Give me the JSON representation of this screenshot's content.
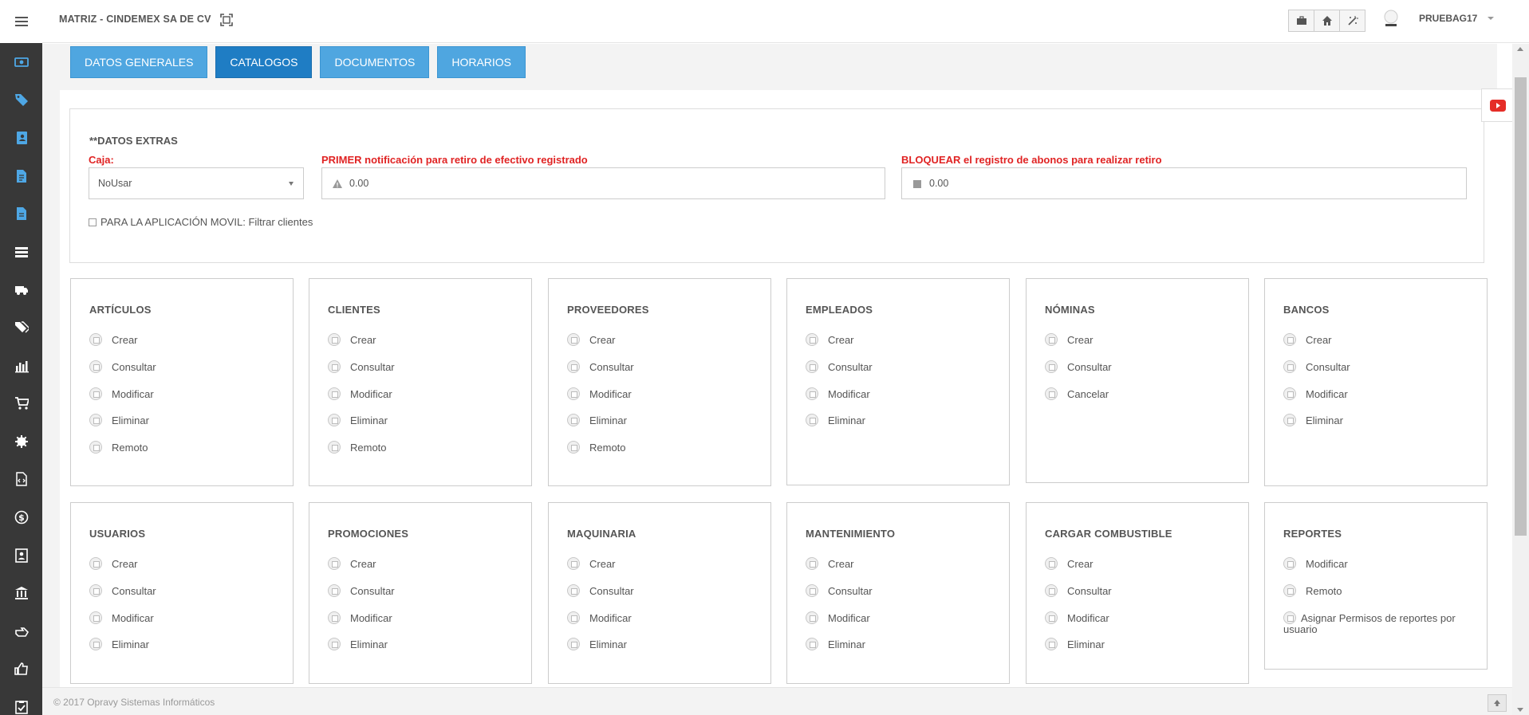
{
  "topbar": {
    "company": "MATRIZ - CINDEMEX SA DE CV",
    "user_name": "PRUEBAG17",
    "icons": [
      "expand-icon",
      "briefcase-icon",
      "home-icon",
      "magic-icon"
    ]
  },
  "sidebar": {
    "icons": [
      "money-icon",
      "tag-icon",
      "address-book-icon",
      "document-icon",
      "document-edit-icon",
      "server-icon",
      "ambulance-icon",
      "tags-icon",
      "bar-chart-icon",
      "cart-icon",
      "gear-icon",
      "code-file-icon",
      "dollar-circle-icon",
      "contact-icon",
      "bank-icon",
      "hand-point-icon",
      "thumbs-up-icon",
      "checklist-icon"
    ]
  },
  "tabs": [
    {
      "label": "DATOS GENERALES",
      "active": false
    },
    {
      "label": "CATALOGOS",
      "active": true
    },
    {
      "label": "DOCUMENTOS",
      "active": false
    },
    {
      "label": "HORARIOS",
      "active": false
    }
  ],
  "extras": {
    "title": "**DATOS EXTRAS",
    "caja_label": "Caja:",
    "caja_value": "NoUsar",
    "notif_label": "PRIMER notificación para retiro de efectivo registrado",
    "notif_value": "0.00",
    "block_label": "BLOQUEAR el registro de abonos para realizar retiro",
    "block_value": "0.00",
    "movil_label": "PARA LA APLICACIÓN MOVIL: Filtrar clientes"
  },
  "cards": [
    {
      "title": "ARTÍCULOS",
      "items": [
        "Crear",
        "Consultar",
        "Modificar",
        "Eliminar",
        "Remoto"
      ]
    },
    {
      "title": "CLIENTES",
      "items": [
        "Crear",
        "Consultar",
        "Modificar",
        "Eliminar",
        "Remoto"
      ]
    },
    {
      "title": "PROVEEDORES",
      "items": [
        "Crear",
        "Consultar",
        "Modificar",
        "Eliminar",
        "Remoto"
      ]
    },
    {
      "title": "EMPLEADOS",
      "items": [
        "Crear",
        "Consultar",
        "Modificar",
        "Eliminar"
      ]
    },
    {
      "title": "NÓMINAS",
      "items": [
        "Crear",
        "Consultar",
        "Cancelar"
      ]
    },
    {
      "title": "BANCOS",
      "items": [
        "Crear",
        "Consultar",
        "Modificar",
        "Eliminar"
      ]
    },
    {
      "title": "USUARIOS",
      "items": [
        "Crear",
        "Consultar",
        "Modificar",
        "Eliminar"
      ]
    },
    {
      "title": "PROMOCIONES",
      "items": [
        "Crear",
        "Consultar",
        "Modificar",
        "Eliminar"
      ]
    },
    {
      "title": "MAQUINARIA",
      "items": [
        "Crear",
        "Consultar",
        "Modificar",
        "Eliminar"
      ]
    },
    {
      "title": "MANTENIMIENTO",
      "items": [
        "Crear",
        "Consultar",
        "Modificar",
        "Eliminar"
      ]
    },
    {
      "title": "CARGAR COMBUSTIBLE",
      "items": [
        "Crear",
        "Consultar",
        "Modificar",
        "Eliminar"
      ]
    },
    {
      "title": "REPORTES",
      "items": [
        "Modificar",
        "Remoto",
        "Asignar Permisos de reportes por usuario"
      ]
    }
  ],
  "footer": {
    "text": "© 2017 Opravy Sistemas Informáticos"
  },
  "colors": {
    "sidebar_bg": "#383838",
    "sidebar_icon": "#4ea7e5",
    "tab": "#4fa6e0",
    "tab_active": "#1f7dc4",
    "label_red": "#e02323"
  }
}
